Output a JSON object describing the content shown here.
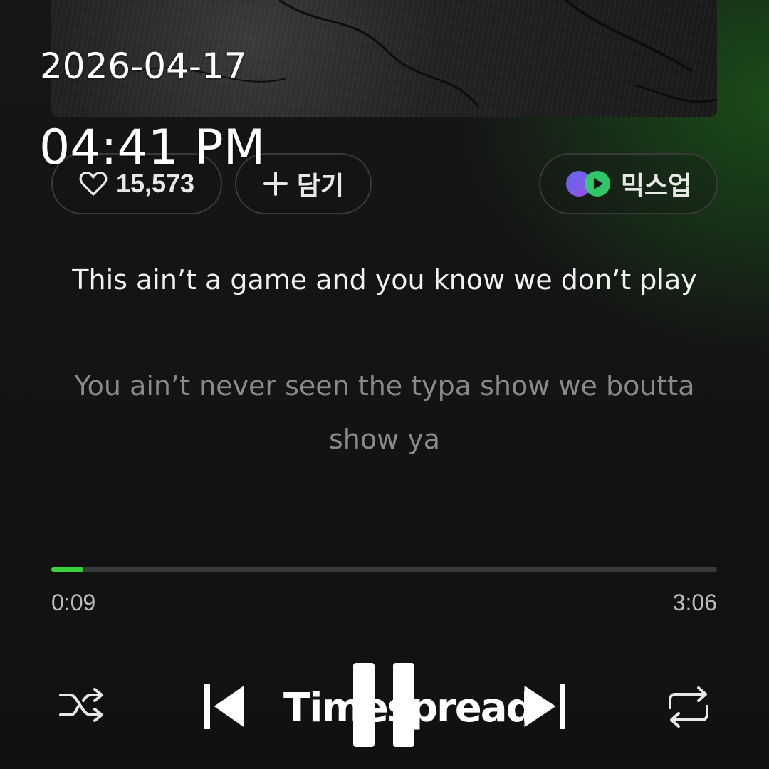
{
  "overlay": {
    "date": "2026-04-17",
    "time": "04:41 PM"
  },
  "actions": {
    "like_count": "15,573",
    "add_label": "담기",
    "mixup_label": "믹스업"
  },
  "lyrics": {
    "current": "This ain’t a game and you know we don’t play",
    "next": "You ain’t never seen the typa show we boutta show ya"
  },
  "player": {
    "elapsed": "0:09",
    "total": "3:06",
    "progress_fraction": 0.048,
    "progress_color": "#3ad13a"
  },
  "watermark": {
    "text": "Timespread"
  },
  "colors": {
    "background": "#121212",
    "accent_green": "#3ad13a",
    "lyric_active": "#f2f2f2",
    "lyric_inactive": "#8a8a8a"
  },
  "icons": {
    "like": "heart-icon",
    "add": "plus-icon",
    "mixup": "mixup-logo-icon",
    "shuffle": "shuffle-icon",
    "previous": "skip-previous-icon",
    "pause": "pause-icon",
    "next": "skip-next-icon",
    "repeat": "repeat-icon"
  }
}
